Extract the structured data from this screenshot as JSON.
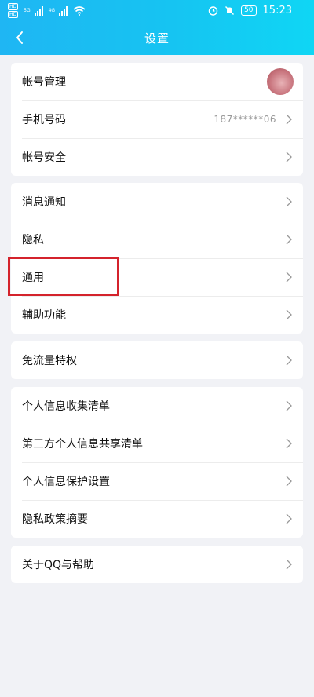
{
  "status_bar": {
    "sim1": "HD",
    "sim1_net": "5G",
    "sim2": "HD",
    "sim2_net": "4G",
    "battery": "50",
    "time": "15:23"
  },
  "nav": {
    "title": "设置"
  },
  "groups": [
    {
      "items": [
        {
          "label": "帐号管理"
        },
        {
          "label": "手机号码",
          "value": "187******06"
        },
        {
          "label": "帐号安全"
        }
      ]
    },
    {
      "items": [
        {
          "label": "消息通知"
        },
        {
          "label": "隐私"
        },
        {
          "label": "通用"
        },
        {
          "label": "辅助功能"
        }
      ]
    },
    {
      "items": [
        {
          "label": "免流量特权"
        }
      ]
    },
    {
      "items": [
        {
          "label": "个人信息收集清单"
        },
        {
          "label": "第三方个人信息共享清单"
        },
        {
          "label": "个人信息保护设置"
        },
        {
          "label": "隐私政策摘要"
        }
      ]
    },
    {
      "items": [
        {
          "label": "关于QQ与帮助"
        }
      ]
    }
  ],
  "colors": {
    "header_start": "#1fb6f3",
    "header_end": "#0fd6f4",
    "background": "#f1f2f6",
    "highlight": "#d4232c"
  },
  "icons": [
    "back-arrow-icon",
    "wifi-icon",
    "alarm-icon",
    "mute-bell-icon",
    "battery-icon",
    "chevron-right-icon"
  ]
}
